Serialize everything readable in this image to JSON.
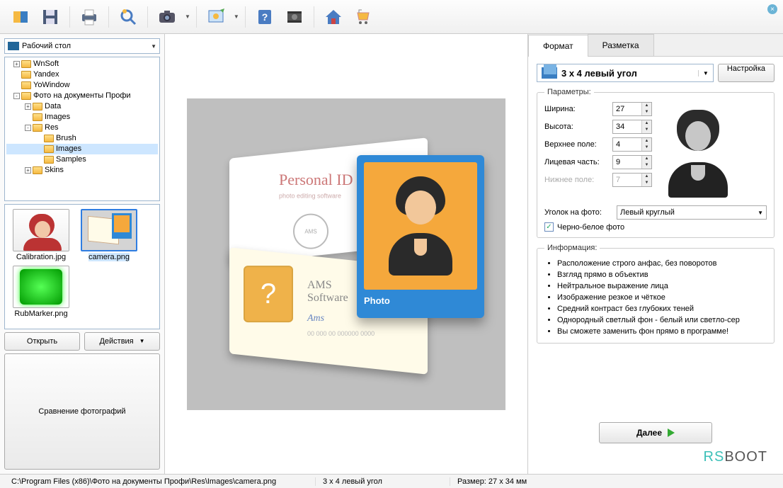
{
  "toolbar": {
    "buttons": [
      "open-icon",
      "save-icon",
      "print-icon",
      "zoom-icon",
      "camera-icon",
      "capture-icon",
      "help-icon",
      "video-icon",
      "home-icon",
      "cart-icon"
    ]
  },
  "leftpanel": {
    "location": "Рабочий стол",
    "open_btn": "Открыть",
    "actions_btn": "Действия",
    "compare_btn": "Сравнение фотографий"
  },
  "tree": [
    {
      "depth": 0,
      "tw": "+",
      "label": "WnSoft"
    },
    {
      "depth": 0,
      "tw": "",
      "label": "Yandex"
    },
    {
      "depth": 0,
      "tw": "",
      "label": "YoWindow"
    },
    {
      "depth": 0,
      "tw": "-",
      "label": "Фото на документы Профи"
    },
    {
      "depth": 1,
      "tw": "+",
      "label": "Data"
    },
    {
      "depth": 1,
      "tw": "",
      "label": "Images"
    },
    {
      "depth": 1,
      "tw": "-",
      "label": "Res"
    },
    {
      "depth": 2,
      "tw": "",
      "label": "Brush"
    },
    {
      "depth": 2,
      "tw": "",
      "label": "Images",
      "selected": true
    },
    {
      "depth": 2,
      "tw": "",
      "label": "Samples"
    },
    {
      "depth": 1,
      "tw": "+",
      "label": "Skins"
    }
  ],
  "thumbs": [
    {
      "name": "Calibration.jpg",
      "kind": "calib"
    },
    {
      "name": "camera.png",
      "kind": "cam",
      "selected": true
    },
    {
      "name": "RubMarker.png",
      "kind": "rub"
    }
  ],
  "canvas": {
    "pid": "Personal ID",
    "sub": "photo editing software",
    "stamp": "AMS",
    "ams1": "AMS",
    "ams2": "Software",
    "sig": "Ams",
    "dots": "00 000  00 000000 0000",
    "plabel": "Photo"
  },
  "right": {
    "tab_format": "Формат",
    "tab_layout": "Разметка",
    "format_value": "3 x 4 левый угол",
    "settings_btn": "Настройка",
    "params_legend": "Параметры:",
    "width_lbl": "Ширина:",
    "width_val": "27",
    "height_lbl": "Высота:",
    "height_val": "34",
    "top_lbl": "Верхнее поле:",
    "top_val": "4",
    "face_lbl": "Лицевая часть:",
    "face_val": "9",
    "bottom_lbl": "Нижнее поле:",
    "bottom_val": "7",
    "corner_lbl": "Уголок на фото:",
    "corner_val": "Левый круглый",
    "bw_label": "Черно-белое фото",
    "info_legend": "Информация:",
    "info": [
      "Расположение строго анфас, без поворотов",
      "Взгляд прямо в объектив",
      "Нейтральное выражение лица",
      "Изображение резкое и чёткое",
      "Средний контраст без глубоких теней",
      "Однородный светлый фон - белый или светло-сер",
      "Вы сможете заменить фон прямо в программе!"
    ],
    "next_btn": "Далее"
  },
  "brand": {
    "a": "RS",
    "b": "BOOT"
  },
  "status": {
    "path": "C:\\Program Files (x86)\\Фото на документы Профи\\Res\\Images\\camera.png",
    "format": "3 x 4 левый угол",
    "size": "Размер: 27 x 34 мм"
  }
}
